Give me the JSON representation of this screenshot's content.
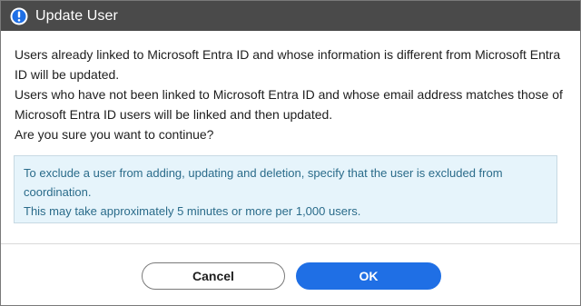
{
  "dialog": {
    "title": "Update User",
    "title_icon": "exclamation-circle-icon",
    "message_lines": [
      "Users already linked to Microsoft Entra ID and whose information is different from Microsoft Entra ID will be updated.",
      "Users who have not been linked to Microsoft Entra ID and whose email address matches those of Microsoft Entra ID users will be linked and then updated.",
      "Are you sure you want to continue?"
    ],
    "info_lines": [
      "To exclude a user from adding, updating and deletion, specify that the user is excluded from coordination.",
      "This may take approximately 5 minutes or more per 1,000 users."
    ],
    "cancel_label": "Cancel",
    "ok_label": "OK"
  },
  "colors": {
    "titlebar": "#4a4a4a",
    "accent": "#1f6fe5",
    "info_bg": "#e6f4fb",
    "info_text": "#2a6b8a"
  }
}
